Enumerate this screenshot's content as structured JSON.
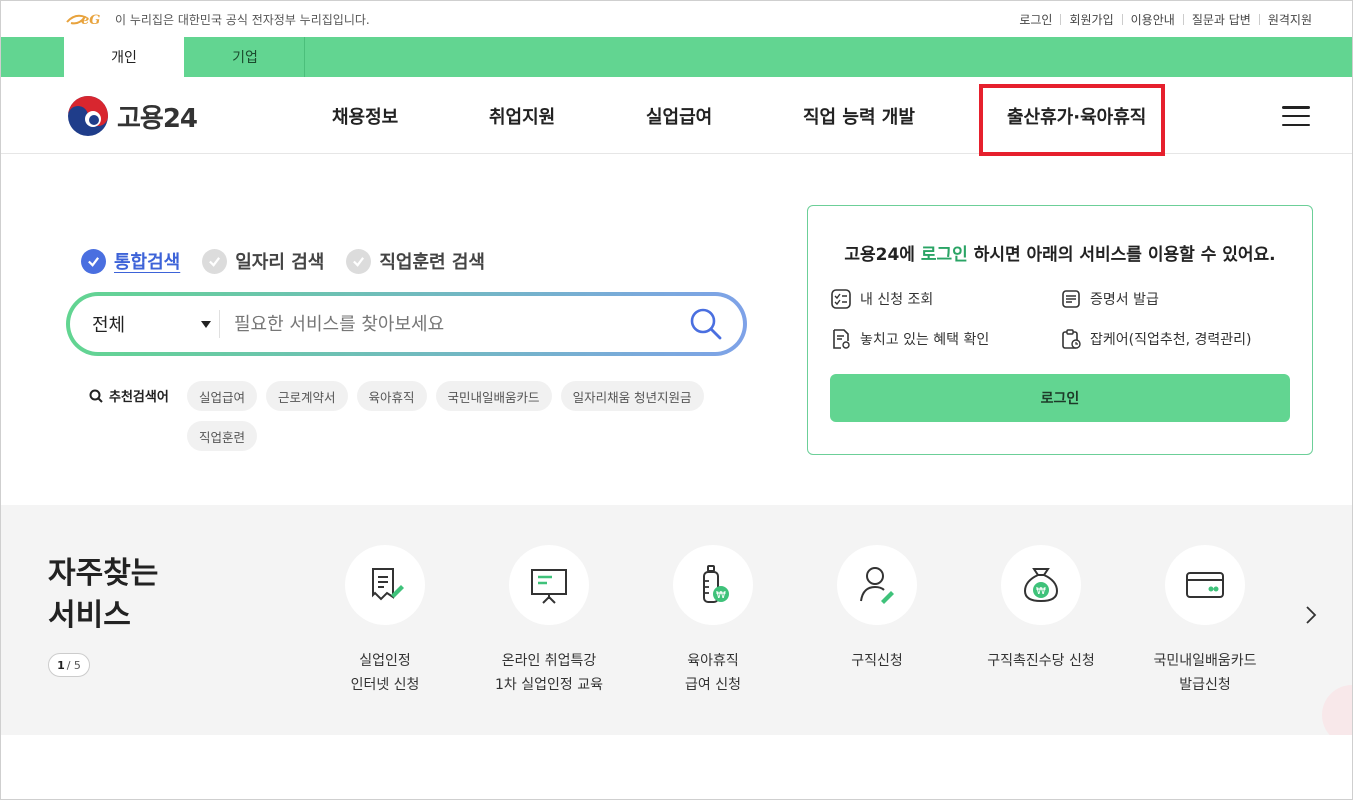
{
  "util_bar": {
    "gov_notice": "이 누리집은 대한민국 공식 전자정부 누리집입니다.",
    "links": [
      "로그인",
      "회원가입",
      "이용안내",
      "질문과 답변",
      "원격지원"
    ]
  },
  "tabs": {
    "personal": "개인",
    "business": "기업"
  },
  "header": {
    "logo_text": "고용24",
    "nav": [
      "채용정보",
      "취업지원",
      "실업급여",
      "직업 능력 개발",
      "출산휴가·육아휴직"
    ],
    "highlighted_nav": "출산휴가·육아휴직"
  },
  "search": {
    "types": [
      "통합검색",
      "일자리 검색",
      "직업훈련 검색"
    ],
    "selected_type": "통합검색",
    "category": "전체",
    "placeholder": "필요한 서비스를 찾아보세요",
    "recommend_label": "추천검색어",
    "keywords": [
      "실업급여",
      "근로계약서",
      "육아휴직",
      "국민내일배움카드",
      "일자리채움 청년지원금",
      "직업훈련"
    ]
  },
  "login_card": {
    "message_prefix": "고용24에 ",
    "message_highlight": "로그인",
    "message_suffix": " 하시면 아래의 서비스를 이용할 수 있어요.",
    "services": [
      "내 신청 조회",
      "증명서 발급",
      "놓치고 있는 혜택 확인",
      "잡케어(직업추천, 경력관리)"
    ],
    "button": "로그인"
  },
  "frequent": {
    "title_line1": "자주찾는",
    "title_line2": "서비스",
    "page_current": "1",
    "page_total": "/ 5",
    "items": [
      {
        "line1": "실업인정",
        "line2": "인터넷 신청",
        "icon": "document-pen-icon"
      },
      {
        "line1": "온라인 취업특강",
        "line2": "1차 실업인정 교육",
        "icon": "presentation-board-icon"
      },
      {
        "line1": "육아휴직",
        "line2": "급여 신청",
        "icon": "baby-bottle-icon"
      },
      {
        "line1": "구직신청",
        "line2": "",
        "icon": "person-pen-icon"
      },
      {
        "line1": "구직촉진수당 신청",
        "line2": "",
        "icon": "money-bag-icon"
      },
      {
        "line1": "국민내일배움카드",
        "line2": "발급신청",
        "icon": "card-icon"
      }
    ]
  },
  "colors": {
    "brand_green": "#62d591",
    "accent_blue": "#3d63d8",
    "highlight_red": "#e6202d"
  }
}
